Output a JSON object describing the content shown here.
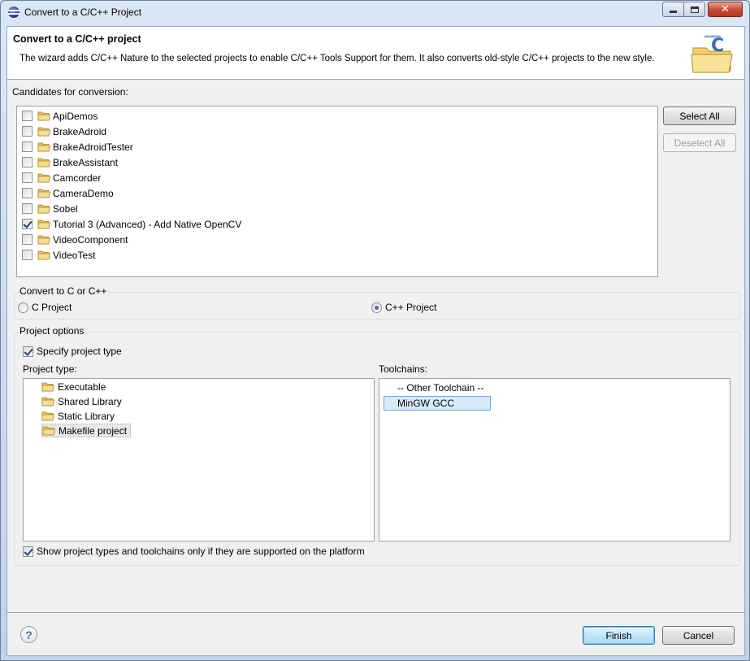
{
  "window": {
    "title": "Convert to a C/C++ Project",
    "controls": {
      "minimize": "minimize-icon",
      "maximize": "maximize-icon",
      "close": "✕"
    }
  },
  "header": {
    "title": "Convert to a C/C++ project",
    "description": "The wizard adds C/C++ Nature to the selected projects to enable C/C++ Tools Support for them. It also converts old-style C/C++ projects to the new style."
  },
  "candidates": {
    "label": "Candidates for conversion:",
    "items": [
      {
        "label": "ApiDemos",
        "checked": false
      },
      {
        "label": "BrakeAdroid",
        "checked": false
      },
      {
        "label": "BrakeAdroidTester",
        "checked": false
      },
      {
        "label": "BrakeAssistant",
        "checked": false
      },
      {
        "label": "Camcorder",
        "checked": false
      },
      {
        "label": "CameraDemo",
        "checked": false
      },
      {
        "label": "Sobel",
        "checked": false
      },
      {
        "label": "Tutorial 3 (Advanced) - Add Native OpenCV",
        "checked": true
      },
      {
        "label": "VideoComponent",
        "checked": false
      },
      {
        "label": "VideoTest",
        "checked": false
      }
    ],
    "select_all": "Select All",
    "deselect_all": "Deselect All"
  },
  "convert_group": {
    "label": "Convert to C or C++",
    "c_project": "C Project",
    "cpp_project": "C++ Project",
    "selected": "C++ Project"
  },
  "project_options": {
    "label": "Project options",
    "specify_type": "Specify project type",
    "specify_type_checked": true,
    "project_type_label": "Project type:",
    "project_types": [
      "Executable",
      "Shared Library",
      "Static Library",
      "Makefile project"
    ],
    "selected_type": "Makefile project",
    "toolchains_label": "Toolchains:",
    "toolchains": [
      "-- Other Toolchain --",
      "MinGW GCC"
    ],
    "selected_toolchain": "MinGW GCC",
    "show_supported": "Show project types and toolchains only if they are supported on the platform",
    "show_supported_checked": true
  },
  "footer": {
    "help": "?",
    "finish": "Finish",
    "cancel": "Cancel"
  },
  "colors": {
    "folder": "#e8c35a",
    "selection": "#d9eafb",
    "default_button": "#bee6fd"
  }
}
